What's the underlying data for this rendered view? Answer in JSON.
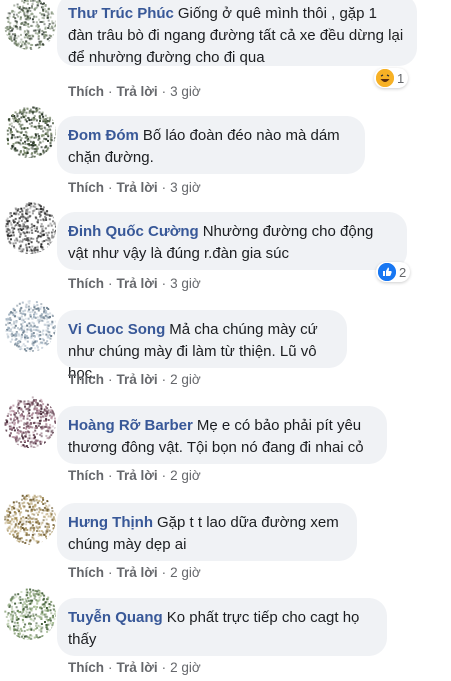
{
  "actions": {
    "like": "Thích",
    "reply": "Trả lời",
    "dot": "·"
  },
  "comments": [
    {
      "author": "Thư Trúc Phúc",
      "text": "Giống ở quê mình thôi , gặp 1 đàn trâu bò đi ngang đường tất cả xe đều dừng lại để nhường đường cho đi qua",
      "time": "3 giờ",
      "reaction_count": "1",
      "reaction_icon": "haha-icon"
    },
    {
      "author": "Đom Đóm",
      "text": "Bố láo đoàn đéo nào mà dám chặn đường.",
      "time": "3 giờ"
    },
    {
      "author": "Đinh Quốc Cường",
      "text": "Nhường đường cho động vật như vậy là đúng r.đàn gia súc",
      "time": "3 giờ",
      "reaction_count": "2",
      "reaction_icon": "like-icon"
    },
    {
      "author": "Vi Cuoc Song",
      "text": "Mả cha chúng mày cứ như chúng mày đi làm từ thiện. Lũ vô học.",
      "time": "2 giờ"
    },
    {
      "author": "Hoàng Rỡ Barber",
      "text": "Mẹ e có bảo phải pít yêu thương đông vật. Tội bọn nó đang đi nhai cỏ",
      "time": "2 giờ"
    },
    {
      "author": "Hưng Thịnh",
      "text": "Gặp t t lao dữa đường xem chúng mày dẹp ai",
      "time": "2 giờ"
    },
    {
      "author": "Tuyễn Quang",
      "text": "Ko phất trực tiếp cho cagt họ thấy",
      "time": "2 giờ"
    }
  ]
}
